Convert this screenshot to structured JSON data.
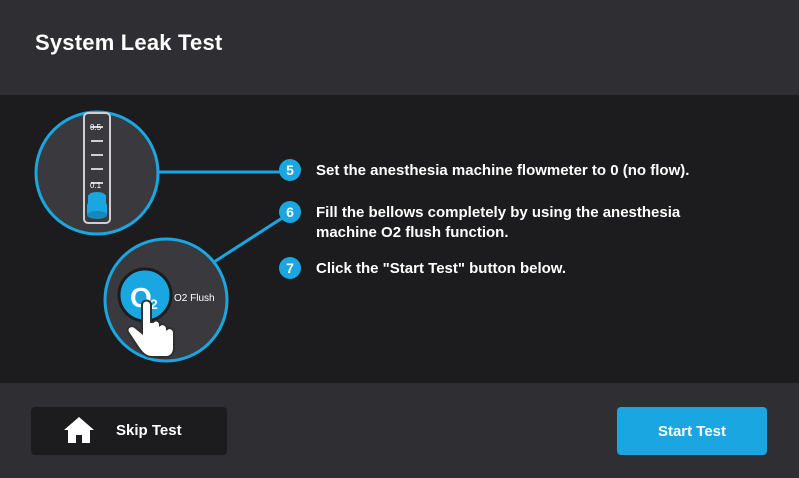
{
  "header": {
    "title": "System Leak Test"
  },
  "illustration": {
    "flowmeter_label_top": "0.5",
    "flowmeter_label_bottom": "0.1",
    "o2_button_symbol": "O",
    "o2_button_subscript": "2",
    "o2_button_caption": "O2 Flush"
  },
  "steps": [
    {
      "number": "5",
      "text": "Set the anesthesia machine flowmeter to 0 (no flow)."
    },
    {
      "number": "6",
      "text": "Fill the bellows completely by using the anesthesia machine O2 flush function."
    },
    {
      "number": "7",
      "text": "Click the \"Start Test\" button below."
    }
  ],
  "footer": {
    "skip_label": "Skip Test",
    "skip_icon": "home-icon",
    "start_label": "Start Test"
  },
  "colors": {
    "accent": "#1aa6e0",
    "header_bg": "#2f2f33",
    "main_bg": "#1c1c1e"
  }
}
